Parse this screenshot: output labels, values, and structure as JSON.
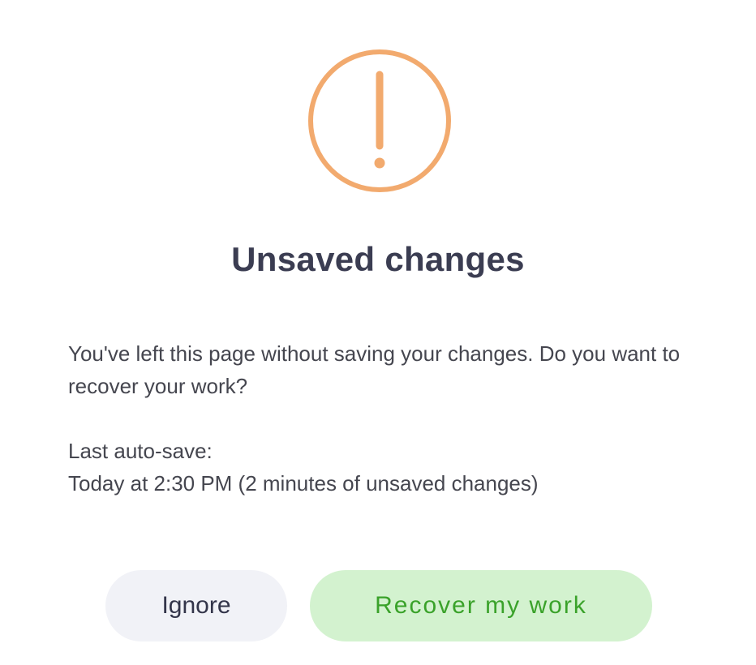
{
  "dialog": {
    "icon": "exclamation-circle-icon",
    "accent_color": "#F2AA6E",
    "title": "Unsaved changes",
    "message": "You've left this page without saving your changes. Do you want to recover your work?",
    "autosave_label": "Last auto-save:",
    "autosave_value": "Today at 2:30 PM (2 minutes of unsaved changes)",
    "buttons": {
      "ignore_label": "Ignore",
      "recover_label": "Recover my work",
      "recover_color": "#3AA22A",
      "recover_bg": "#D3F2CF"
    }
  }
}
